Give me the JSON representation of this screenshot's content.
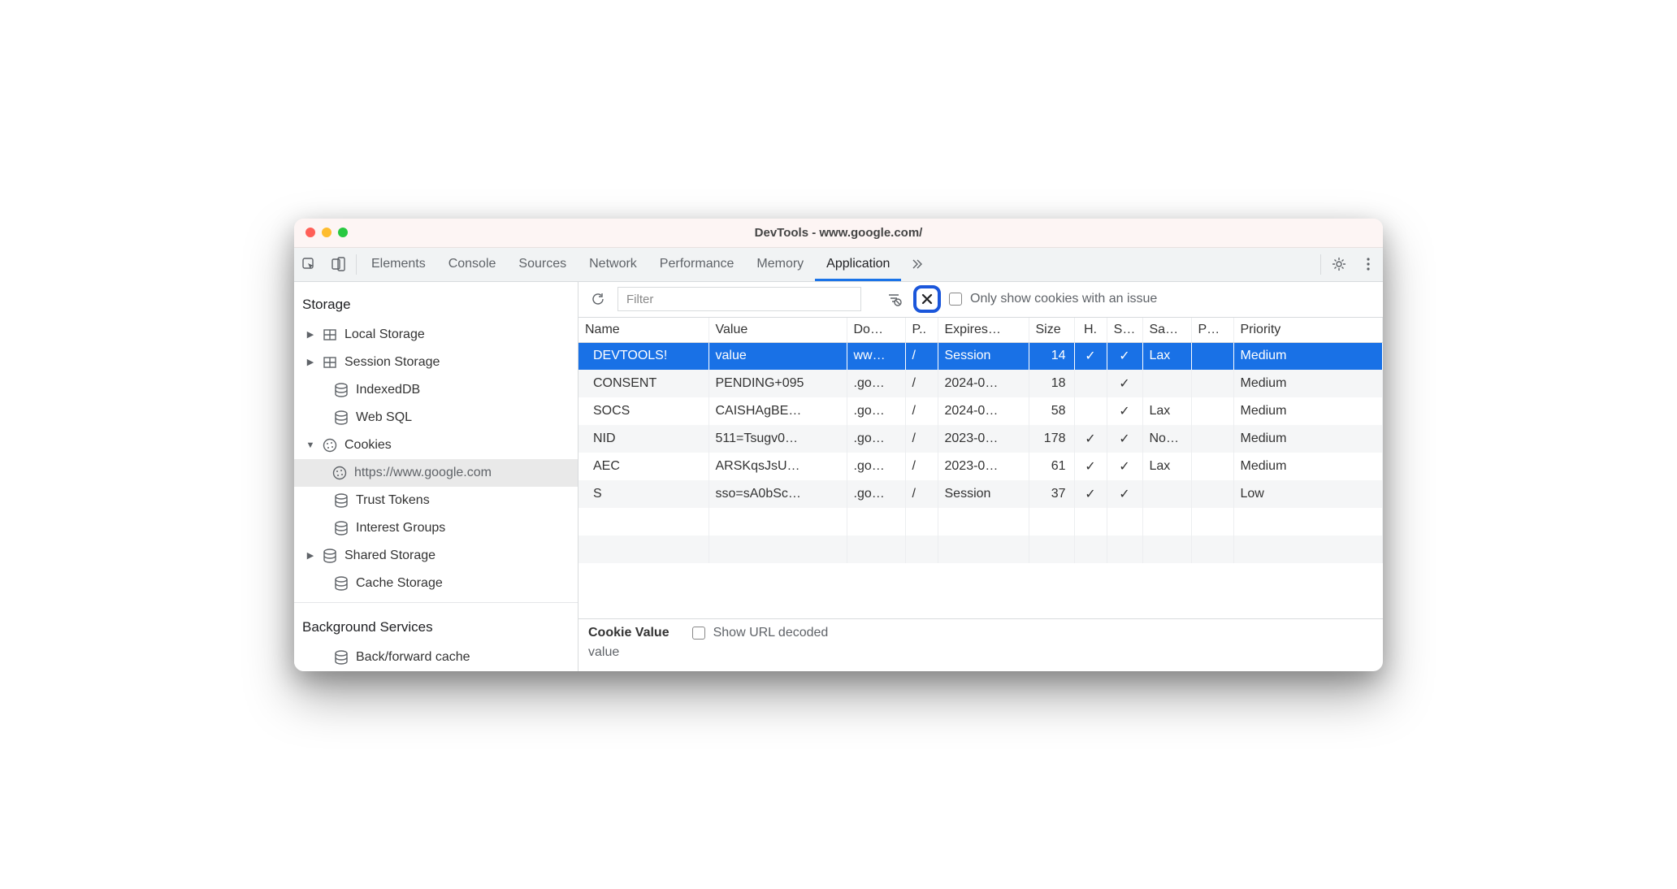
{
  "window": {
    "title": "DevTools - www.google.com/"
  },
  "tabs": {
    "items": [
      "Elements",
      "Console",
      "Sources",
      "Network",
      "Performance",
      "Memory",
      "Application"
    ],
    "active": "Application"
  },
  "sidebar": {
    "groups": [
      {
        "title": "Storage",
        "items": [
          {
            "label": "Local Storage",
            "icon": "grid",
            "expander": "right"
          },
          {
            "label": "Session Storage",
            "icon": "grid",
            "expander": "right"
          },
          {
            "label": "IndexedDB",
            "icon": "db",
            "expander": ""
          },
          {
            "label": "Web SQL",
            "icon": "db",
            "expander": ""
          },
          {
            "label": "Cookies",
            "icon": "cookie",
            "expander": "down",
            "children": [
              {
                "label": "https://www.google.com",
                "icon": "cookie",
                "selected": true
              }
            ]
          },
          {
            "label": "Trust Tokens",
            "icon": "db",
            "expander": ""
          },
          {
            "label": "Interest Groups",
            "icon": "db",
            "expander": ""
          },
          {
            "label": "Shared Storage",
            "icon": "db",
            "expander": "right"
          },
          {
            "label": "Cache Storage",
            "icon": "db",
            "expander": ""
          }
        ]
      },
      {
        "title": "Background Services",
        "items": [
          {
            "label": "Back/forward cache",
            "icon": "db",
            "expander": ""
          }
        ]
      }
    ]
  },
  "toolbar": {
    "filter_placeholder": "Filter",
    "only_issue_label": "Only show cookies with an issue"
  },
  "table": {
    "columns": [
      "Name",
      "Value",
      "Do…",
      "P..",
      "Expires…",
      "Size",
      "H.",
      "S…",
      "Sa…",
      "P…",
      "Priority"
    ],
    "rows": [
      {
        "name": "DEVTOOLS!",
        "value": "value",
        "domain": "ww…",
        "path": "/",
        "expires": "Session",
        "size": "14",
        "http": "✓",
        "secure": "✓",
        "samesite": "Lax",
        "partition": "",
        "priority": "Medium",
        "selected": true
      },
      {
        "name": "CONSENT",
        "value": "PENDING+095",
        "domain": ".go…",
        "path": "/",
        "expires": "2024-0…",
        "size": "18",
        "http": "",
        "secure": "✓",
        "samesite": "",
        "partition": "",
        "priority": "Medium"
      },
      {
        "name": "SOCS",
        "value": "CAISHAgBE…",
        "domain": ".go…",
        "path": "/",
        "expires": "2024-0…",
        "size": "58",
        "http": "",
        "secure": "✓",
        "samesite": "Lax",
        "partition": "",
        "priority": "Medium"
      },
      {
        "name": "NID",
        "value": "511=Tsugv0…",
        "domain": ".go…",
        "path": "/",
        "expires": "2023-0…",
        "size": "178",
        "http": "✓",
        "secure": "✓",
        "samesite": "No…",
        "partition": "",
        "priority": "Medium"
      },
      {
        "name": "AEC",
        "value": "ARSKqsJsU…",
        "domain": ".go…",
        "path": "/",
        "expires": "2023-0…",
        "size": "61",
        "http": "✓",
        "secure": "✓",
        "samesite": "Lax",
        "partition": "",
        "priority": "Medium"
      },
      {
        "name": "S",
        "value": "sso=sA0bSc…",
        "domain": ".go…",
        "path": "/",
        "expires": "Session",
        "size": "37",
        "http": "✓",
        "secure": "✓",
        "samesite": "",
        "partition": "",
        "priority": "Low"
      }
    ]
  },
  "detail": {
    "label": "Cookie Value",
    "decoded_label": "Show URL decoded",
    "value": "value"
  }
}
